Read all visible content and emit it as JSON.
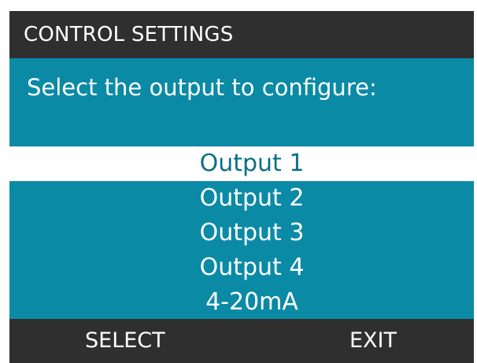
{
  "title": "CONTROL SETTINGS",
  "prompt": "Select the output to configure:",
  "menu": {
    "items": [
      {
        "label": "Output 1",
        "selected": true
      },
      {
        "label": "Output 2",
        "selected": false
      },
      {
        "label": "Output 3",
        "selected": false
      },
      {
        "label": "Output 4",
        "selected": false
      },
      {
        "label": "4-20mA",
        "selected": false
      }
    ]
  },
  "softkeys": {
    "left": "SELECT",
    "right": "EXIT"
  },
  "colors": {
    "screen_bg": "#0b8aa6",
    "bar_bg": "#2f2f2f",
    "highlight_bg": "#ffffff",
    "highlight_text": "#0b6f88"
  }
}
